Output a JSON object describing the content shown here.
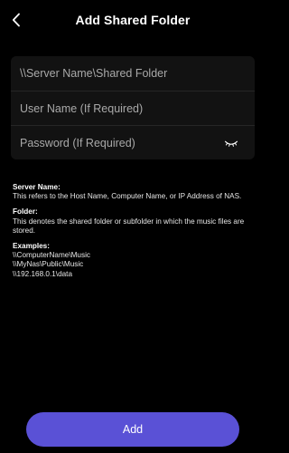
{
  "header": {
    "title": "Add Shared Folder",
    "back_icon": "chevron-left-icon"
  },
  "form": {
    "server_path_placeholder": "\\\\Server Name\\Shared Folder",
    "username_placeholder": "User Name (If Required)",
    "password_placeholder": "Password (If Required)",
    "password_toggle_icon": "eye-closed-icon"
  },
  "info": {
    "server_name_label": "Server Name:",
    "server_name_text": "This refers to the Host Name, Computer Name, or IP Address of NAS.",
    "folder_label": "Folder:",
    "folder_text": "This denotes the shared folder or subfolder in which the music files are stored.",
    "examples_label": "Examples:",
    "examples": [
      "\\\\ComputerName\\Music",
      "\\\\MyNas\\Public\\Music",
      "\\\\192.168.0.1\\data"
    ]
  },
  "actions": {
    "add_label": "Add"
  },
  "colors": {
    "background": "#000000",
    "card": "#121212",
    "accent": "#5a51d6",
    "placeholder": "#a9a9a9"
  }
}
